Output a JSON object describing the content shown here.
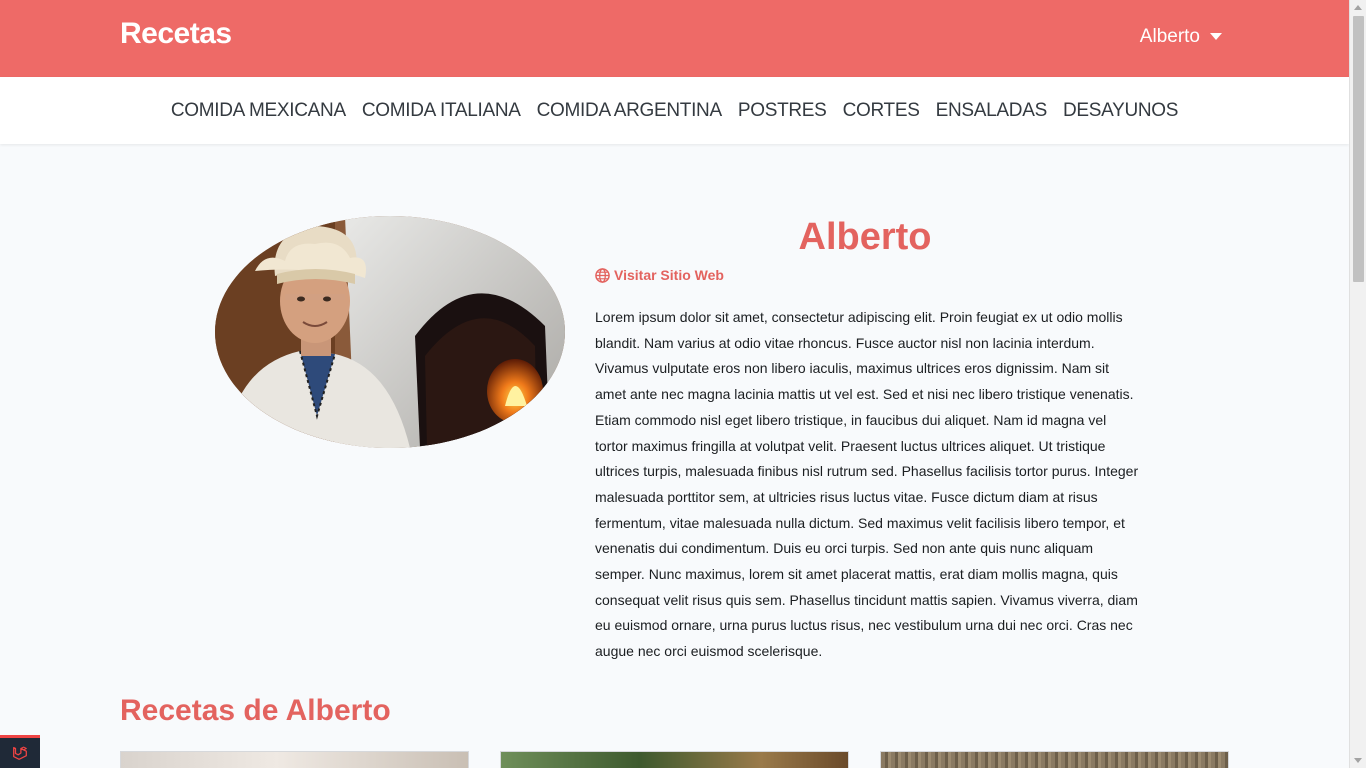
{
  "header": {
    "brand": "Recetas",
    "user_name": "Alberto",
    "accent_color": "#ee6a67"
  },
  "categories": [
    "COMIDA MEXICANA",
    "COMIDA ITALIANA",
    "COMIDA ARGENTINA",
    "POSTRES",
    "CORTES",
    "ENSALADAS",
    "DESAYUNOS"
  ],
  "profile": {
    "name": "Alberto",
    "website_label": "Visitar Sitio Web",
    "website_icon": "globe-icon",
    "avatar_icon": "chef-photo",
    "bio": "Lorem ipsum dolor sit amet, consectetur adipiscing elit. Proin feugiat ex ut odio mollis blandit. Nam varius at odio vitae rhoncus. Fusce auctor nisl non lacinia interdum. Vivamus vulputate eros non libero iaculis, maximus ultrices eros dignissim. Nam sit amet ante nec magna lacinia mattis ut vel est. Sed et nisi nec libero tristique venenatis. Etiam commodo nisl eget libero tristique, in faucibus dui aliquet. Nam id magna vel tortor maximus fringilla at volutpat velit. Praesent luctus ultrices aliquet. Ut tristique ultrices turpis, malesuada finibus nisl rutrum sed. Phasellus facilisis tortor purus. Integer malesuada porttitor sem, at ultricies risus luctus vitae. Fusce dictum diam at risus fermentum, vitae malesuada nulla dictum. Sed maximus velit facilisis libero tempor, et venenatis dui condimentum. Duis eu orci turpis. Sed non ante quis nunc aliquam semper. Nunc maximus, lorem sit amet placerat mattis, erat diam mollis magna, quis consequat velit risus quis sem. Phasellus tincidunt mattis sapien. Vivamus viverra, diam eu euismod ornare, urna purus luctus risus, nec vestibulum urna dui nec orci. Cras nec augue nec orci euismod scelerisque."
  },
  "recipes_section": {
    "title": "Recetas de Alberto"
  }
}
